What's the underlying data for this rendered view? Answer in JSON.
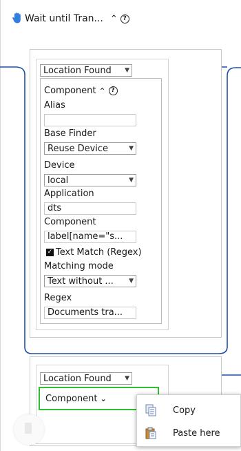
{
  "header": {
    "title": "Wait until Tran...",
    "collapse_icon": "chevron-up-icon",
    "help_icon": "question-circle-icon",
    "step_icon": "hand-icon"
  },
  "block1": {
    "location_select": "Location Found",
    "component": {
      "title": "Component",
      "alias_label": "Alias",
      "alias_value": "",
      "base_finder_label": "Base Finder",
      "base_finder_value": "Reuse Device",
      "device_label": "Device",
      "device_value": "local",
      "application_label": "Application",
      "application_value": "dts",
      "component_label": "Component",
      "component_value": "label[name=\"s...",
      "text_match_label": "Text Match (Regex)",
      "text_match_checked": true,
      "matching_mode_label": "Matching mode",
      "matching_mode_value": "Text without ...",
      "regex_label": "Regex",
      "regex_value": "Documents tra..."
    }
  },
  "block2": {
    "location_select": "Location Found",
    "component_label": "Component"
  },
  "context_menu": {
    "items": [
      {
        "label": "Copy",
        "icon": "copy-icon"
      },
      {
        "label": "Paste here",
        "icon": "paste-icon"
      }
    ]
  },
  "colors": {
    "flow_line": "#1f4fa8",
    "selection_border": "#2fbf2f",
    "hand_icon": "#2f7ee0"
  }
}
